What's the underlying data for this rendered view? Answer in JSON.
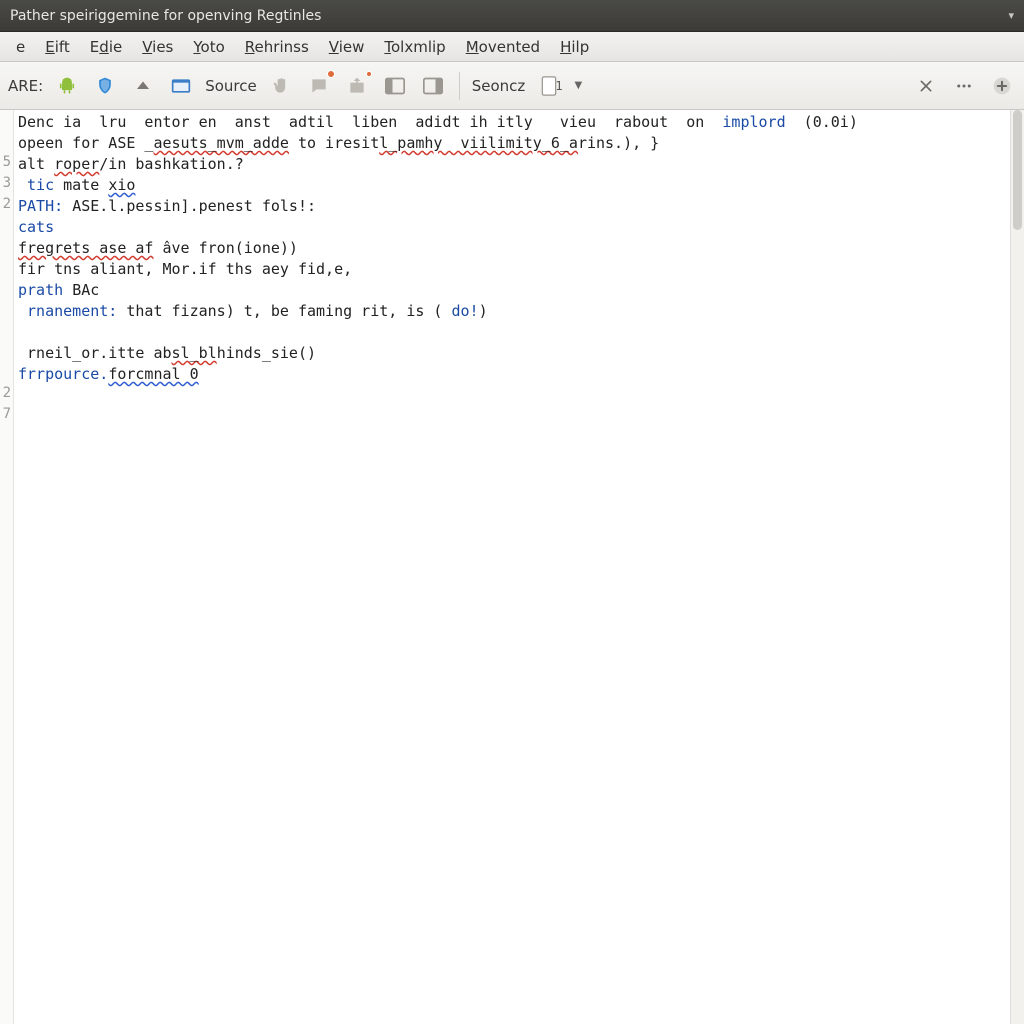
{
  "window": {
    "title": "Pather speiriggemine for openving Regtinles",
    "dropdown_caret": "▾"
  },
  "menubar": {
    "items": [
      {
        "label": "e",
        "mnemonic_index": 0
      },
      {
        "label": "Eift",
        "mnemonic_index": 0
      },
      {
        "label": "Edie",
        "mnemonic_index": 1
      },
      {
        "label": "Vies",
        "mnemonic_index": 0
      },
      {
        "label": "Yoto",
        "mnemonic_index": 0
      },
      {
        "label": "Rehrinss",
        "mnemonic_index": 0
      },
      {
        "label": "View",
        "mnemonic_index": 0
      },
      {
        "label": "Tolxmlip",
        "mnemonic_index": 0
      },
      {
        "label": "Movented",
        "mnemonic_index": 0
      },
      {
        "label": "Hilp",
        "mnemonic_index": 0
      }
    ]
  },
  "toolbar": {
    "left_label": "ARE:",
    "source_label": "Source",
    "seoncz_label": "Seoncz",
    "page_num": "1",
    "icons": {
      "android": "android-icon",
      "shield": "shield-icon",
      "up": "chevron-up-icon",
      "rect": "window-icon",
      "hand": "hand-icon",
      "chat": "chat-icon",
      "export": "export-icon",
      "panel1": "panel-left-icon",
      "panel2": "panel-right-icon",
      "close": "close-icon",
      "overflow": "more-icon",
      "add": "plus-circle-icon"
    }
  },
  "editor": {
    "gutter_numbers": [
      "",
      "",
      "5",
      "3",
      "2",
      "",
      "",
      "",
      "",
      "",
      "",
      "",
      "",
      "2",
      "7"
    ],
    "lines": [
      {
        "segments": [
          {
            "t": "Denc ia  lru  entor en  anst  adtil  liben  adidt ih itly   vieu  rabout  on  ",
            "cls": "txt"
          },
          {
            "t": "implord",
            "cls": "kw"
          },
          {
            "t": "  (0.0i)",
            "cls": "txt"
          }
        ]
      },
      {
        "segments": [
          {
            "t": "opeen for ASE _",
            "cls": "txt"
          },
          {
            "t": "aesuts_mvm_adde",
            "cls": "spellerr"
          },
          {
            "t": " to iresit",
            "cls": "txt"
          },
          {
            "t": "l_pamhy  viilimity_6_a",
            "cls": "spellerr"
          },
          {
            "t": "rins.), }",
            "cls": "txt"
          }
        ]
      },
      {
        "segments": [
          {
            "t": "alt ",
            "cls": "txt"
          },
          {
            "t": "roper",
            "cls": "spellerr"
          },
          {
            "t": "/in bashkation.?",
            "cls": "txt"
          }
        ]
      },
      {
        "segments": [
          {
            "t": " tic ",
            "cls": "kw"
          },
          {
            "t": "mate ",
            "cls": "txt"
          },
          {
            "t": "xio",
            "cls": "spellerr-blue"
          }
        ]
      },
      {
        "segments": [
          {
            "t": "PATH: ",
            "cls": "kw"
          },
          {
            "t": "ASE.l.pessin].penest fols!:",
            "cls": "txt"
          }
        ]
      },
      {
        "segments": [
          {
            "t": "cats",
            "cls": "kw"
          }
        ]
      },
      {
        "segments": [
          {
            "t": "fregrets ase af",
            "cls": "spellerr"
          },
          {
            "t": " âve fron(ione))",
            "cls": "txt"
          }
        ]
      },
      {
        "segments": [
          {
            "t": "fir tns aliant, Mor.if ths aey fid,e,",
            "cls": "txt"
          }
        ]
      },
      {
        "segments": [
          {
            "t": "prath ",
            "cls": "kw"
          },
          {
            "t": "BAc",
            "cls": "txt"
          }
        ]
      },
      {
        "segments": [
          {
            "t": " rnanement:",
            "cls": "kw"
          },
          {
            "t": " that fizans) t, be faming rit, is ( ",
            "cls": "txt"
          },
          {
            "t": "do!",
            "cls": "kw"
          },
          {
            "t": ")",
            "cls": "txt"
          }
        ]
      },
      {
        "segments": [
          {
            "t": "",
            "cls": "txt"
          }
        ]
      },
      {
        "segments": [
          {
            "t": " rneil_or.itte ab",
            "cls": "txt"
          },
          {
            "t": "sl_bl",
            "cls": "spellerr"
          },
          {
            "t": "hinds_sie()",
            "cls": "txt"
          }
        ]
      },
      {
        "segments": [
          {
            "t": "frrpource.",
            "cls": "kw"
          },
          {
            "t": "forcmnal",
            "cls": "spellerr-blue"
          },
          {
            "t": " 0",
            "cls": "spellerr-blue"
          }
        ]
      }
    ]
  },
  "colors": {
    "titlebar_bg": "#3c3b37",
    "toolbar_bg": "#eceae6",
    "keyword": "#1a4aa5",
    "spell_red": "#d33b2f",
    "spell_blue": "#2f5dd3"
  }
}
